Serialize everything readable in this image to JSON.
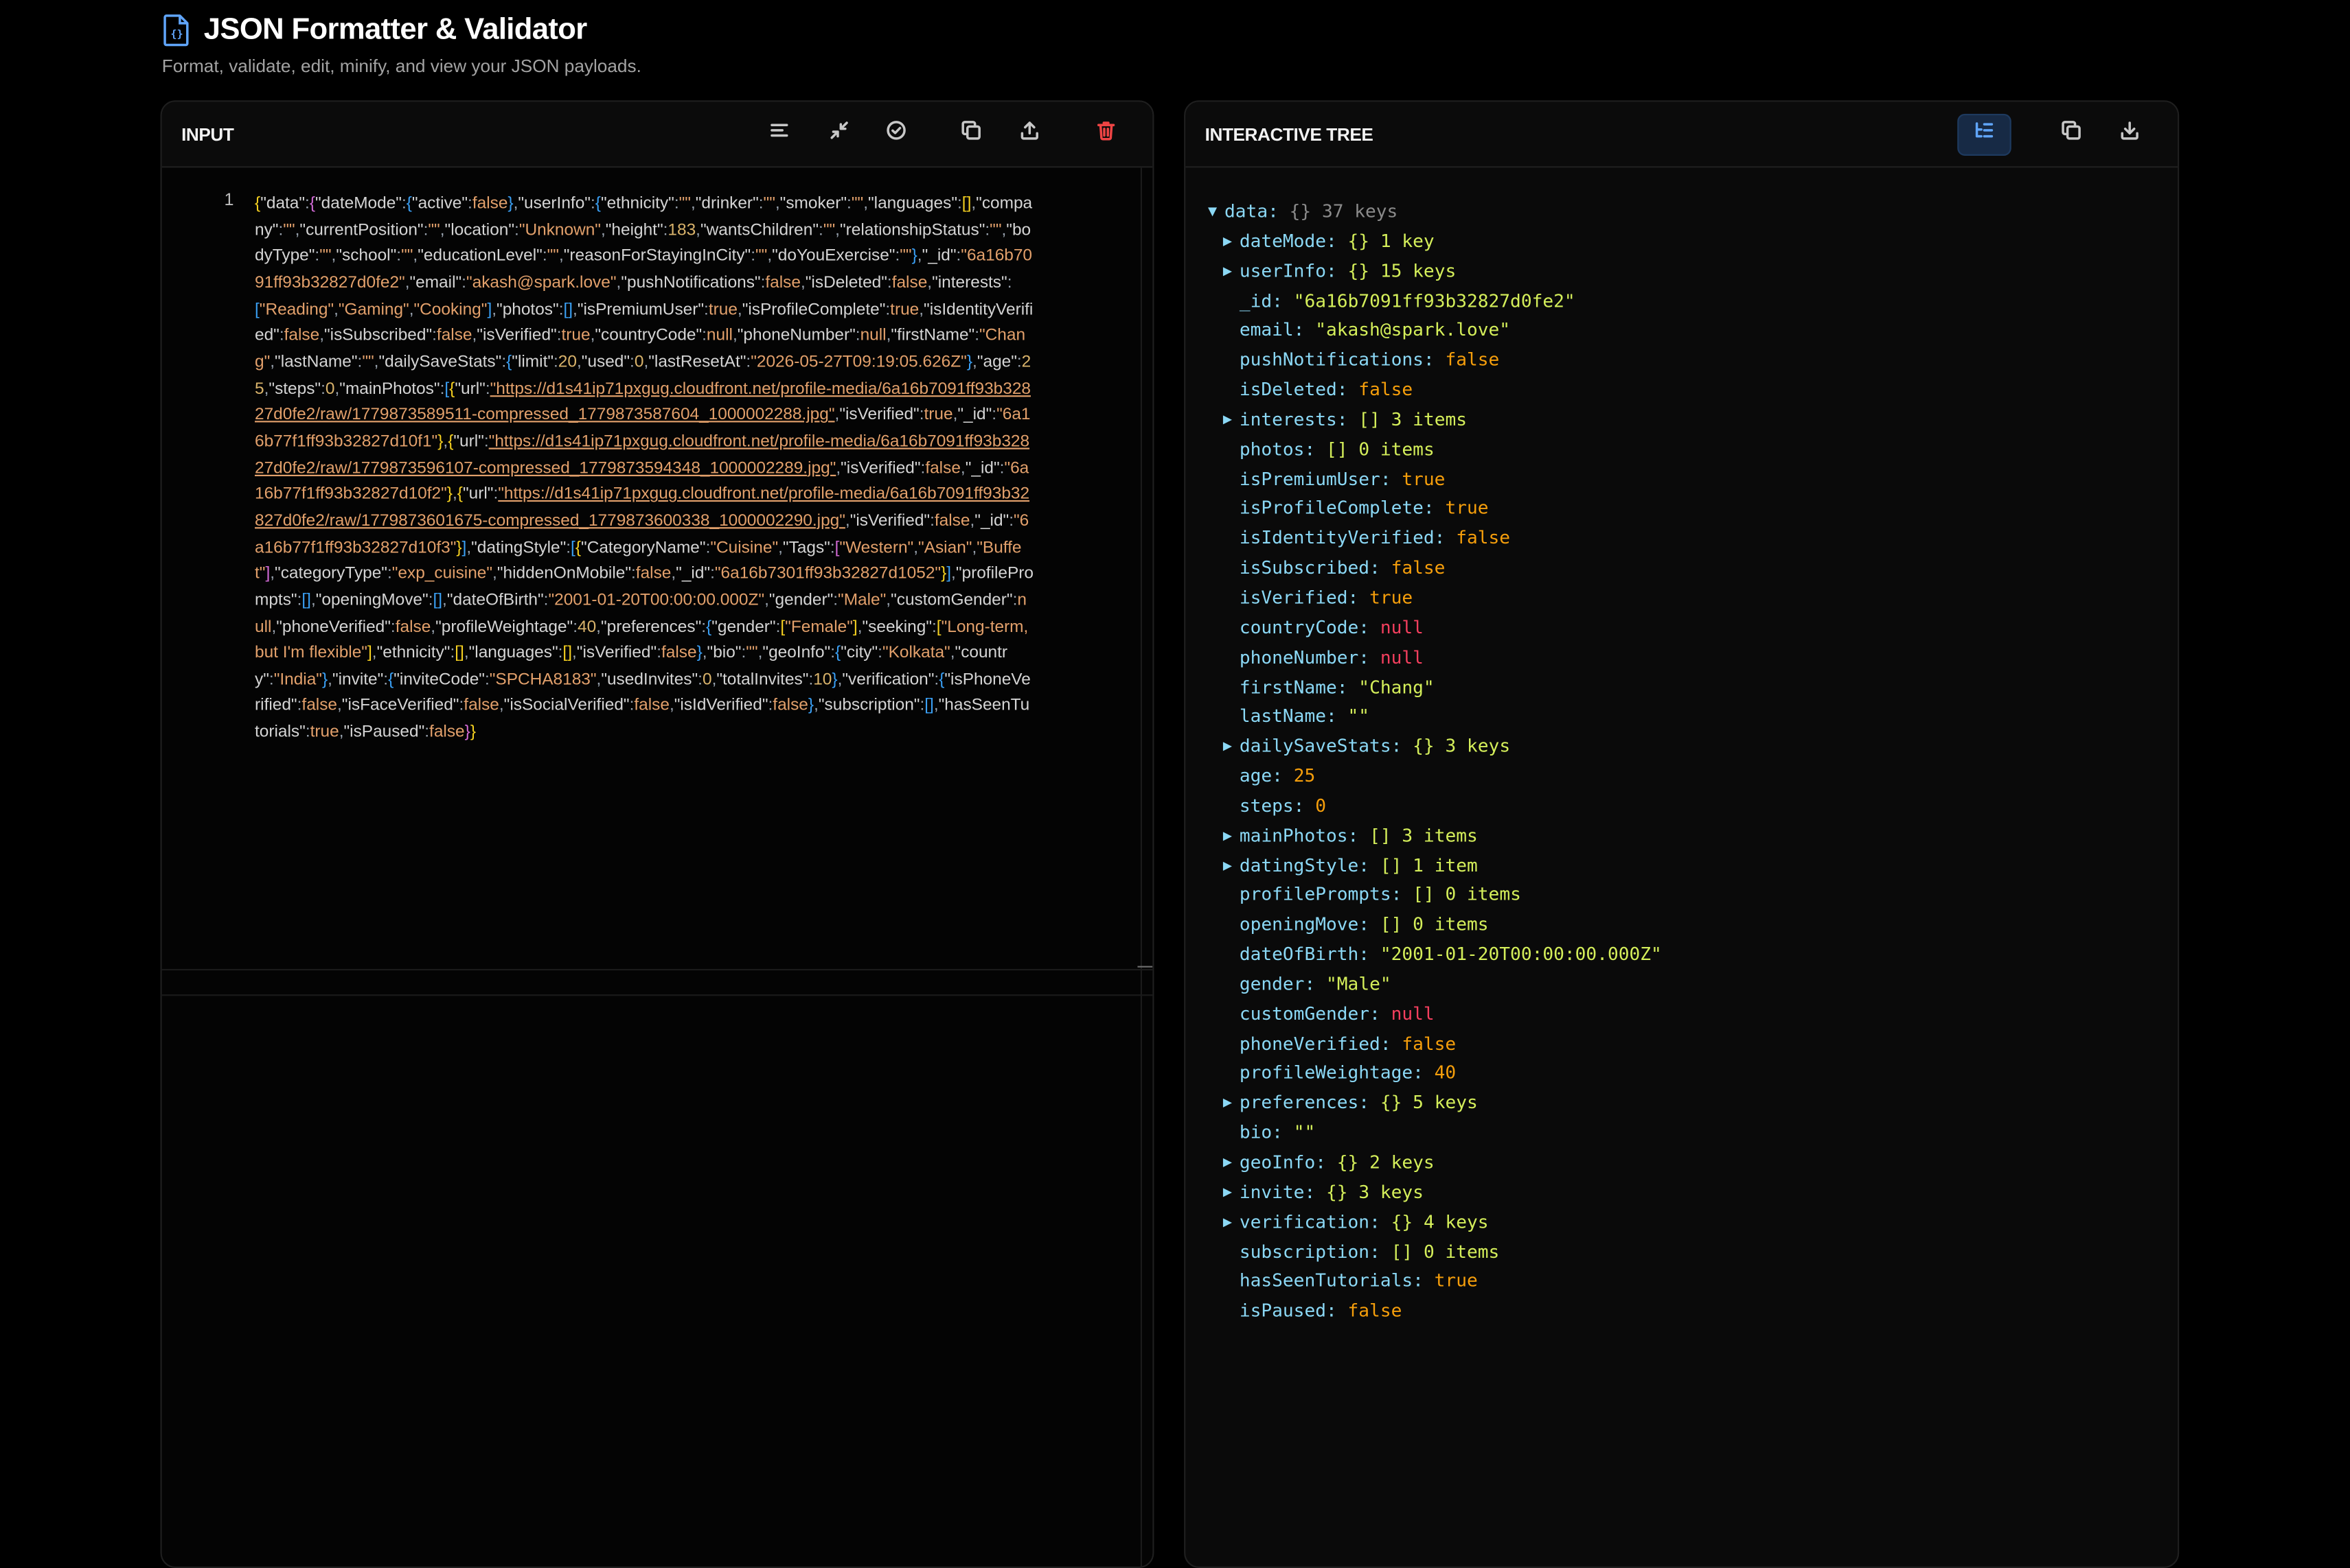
{
  "header": {
    "title": "JSON Formatter & Validator",
    "subtitle": "Format, validate, edit, minify, and view your JSON payloads."
  },
  "input_panel": {
    "label": "INPUT",
    "line_number": "1"
  },
  "tree_panel": {
    "label": "INTERACTIVE TREE",
    "root_key": "data",
    "root_meta": "{} 37 keys"
  },
  "raw_json": "{\"data\":{\"dateMode\":{\"active\":false},\"userInfo\":{\"ethnicity\":\"\",\"drinker\":\"\",\"smoker\":\"\",\"languages\":[],\"company\":\"\",\"currentPosition\":\"\",\"location\":\"Unknown\",\"height\":183,\"wantsChildren\":\"\",\"relationshipStatus\":\"\",\"bodyType\":\"\",\"school\":\"\",\"educationLevel\":\"\",\"reasonForStayingInCity\":\"\",\"doYouExercise\":\"\"},\"_id\":\"6a16b7091ff93b32827d0fe2\",\"email\":\"akash@spark.love\",\"pushNotifications\":false,\"isDeleted\":false,\"interests\":[\"Reading\",\"Gaming\",\"Cooking\"],\"photos\":[],\"isPremiumUser\":true,\"isProfileComplete\":true,\"isIdentityVerified\":false,\"isSubscribed\":false,\"isVerified\":true,\"countryCode\":null,\"phoneNumber\":null,\"firstName\":\"Chang\",\"lastName\":\"\",\"dailySaveStats\":{\"limit\":20,\"used\":0,\"lastResetAt\":\"2026-05-27T09:19:05.626Z\"},\"age\":25,\"steps\":0,\"mainPhotos\":[{\"url\":\"https://d1s41ip71pxgug.cloudfront.net/profile-media/6a16b7091ff93b32827d0fe2/raw/1779873589511-compressed_1779873587604_1000002288.jpg\",\"isVerified\":true,\"_id\":\"6a16b77f1ff93b32827d10f1\"},{\"url\":\"https://d1s41ip71pxgug.cloudfront.net/profile-media/6a16b7091ff93b32827d0fe2/raw/1779873596107-compressed_1779873594348_1000002289.jpg\",\"isVerified\":false,\"_id\":\"6a16b77f1ff93b32827d10f2\"},{\"url\":\"https://d1s41ip71pxgug.cloudfront.net/profile-media/6a16b7091ff93b32827d0fe2/raw/1779873601675-compressed_1779873600338_1000002290.jpg\",\"isVerified\":false,\"_id\":\"6a16b77f1ff93b32827d10f3\"}],\"datingStyle\":[{\"CategoryName\":\"Cuisine\",\"Tags\":[\"Western\",\"Asian\",\"Buffet\"],\"categoryType\":\"exp_cuisine\",\"hiddenOnMobile\":false,\"_id\":\"6a16b7301ff93b32827d1052\"}],\"profilePrompts\":[],\"openingMove\":[],\"dateOfBirth\":\"2001-01-20T00:00:00.000Z\",\"gender\":\"Male\",\"customGender\":null,\"phoneVerified\":false,\"profileWeightage\":40,\"preferences\":{\"gender\":[\"Female\"],\"seeking\":[\"Long-term, but I'm flexible\"],\"ethnicity\":[],\"languages\":[],\"isVerified\":false},\"bio\":\"\",\"geoInfo\":{\"city\":\"Kolkata\",\"country\":\"India\"},\"invite\":{\"inviteCode\":\"SPCHA8183\",\"usedInvites\":0,\"totalInvites\":10},\"verification\":{\"isPhoneVerified\":false,\"isFaceVerified\":false,\"isSocialVerified\":false,\"isIdVerified\":false},\"subscription\":[],\"hasSeenTutorials\":true,\"isPaused\":false}}",
  "tree_rows": [
    {
      "key": "dateMode",
      "type": "obj",
      "meta": "{}",
      "count": "1 key",
      "expandable": true
    },
    {
      "key": "userInfo",
      "type": "obj",
      "meta": "{}",
      "count": "15 keys",
      "expandable": true
    },
    {
      "key": "_id",
      "type": "str",
      "value": "\"6a16b7091ff93b32827d0fe2\""
    },
    {
      "key": "email",
      "type": "str",
      "value": "\"akash@spark.love\""
    },
    {
      "key": "pushNotifications",
      "type": "bool",
      "value": "false"
    },
    {
      "key": "isDeleted",
      "type": "bool",
      "value": "false"
    },
    {
      "key": "interests",
      "type": "arr",
      "meta": "[]",
      "count": "3 items",
      "expandable": true
    },
    {
      "key": "photos",
      "type": "arr",
      "meta": "[]",
      "count": "0 items",
      "expandable": false
    },
    {
      "key": "isPremiumUser",
      "type": "bool",
      "value": "true"
    },
    {
      "key": "isProfileComplete",
      "type": "bool",
      "value": "true"
    },
    {
      "key": "isIdentityVerified",
      "type": "bool",
      "value": "false"
    },
    {
      "key": "isSubscribed",
      "type": "bool",
      "value": "false"
    },
    {
      "key": "isVerified",
      "type": "bool",
      "value": "true"
    },
    {
      "key": "countryCode",
      "type": "null",
      "value": "null"
    },
    {
      "key": "phoneNumber",
      "type": "null",
      "value": "null"
    },
    {
      "key": "firstName",
      "type": "str",
      "value": "\"Chang\""
    },
    {
      "key": "lastName",
      "type": "str",
      "value": "\"\""
    },
    {
      "key": "dailySaveStats",
      "type": "obj",
      "meta": "{}",
      "count": "3 keys",
      "expandable": true
    },
    {
      "key": "age",
      "type": "num",
      "value": "25"
    },
    {
      "key": "steps",
      "type": "num",
      "value": "0"
    },
    {
      "key": "mainPhotos",
      "type": "arr",
      "meta": "[]",
      "count": "3 items",
      "expandable": true
    },
    {
      "key": "datingStyle",
      "type": "arr",
      "meta": "[]",
      "count": "1 item",
      "expandable": true
    },
    {
      "key": "profilePrompts",
      "type": "arr",
      "meta": "[]",
      "count": "0 items",
      "expandable": false
    },
    {
      "key": "openingMove",
      "type": "arr",
      "meta": "[]",
      "count": "0 items",
      "expandable": false
    },
    {
      "key": "dateOfBirth",
      "type": "str",
      "value": "\"2001-01-20T00:00:00.000Z\""
    },
    {
      "key": "gender",
      "type": "str",
      "value": "\"Male\""
    },
    {
      "key": "customGender",
      "type": "null",
      "value": "null"
    },
    {
      "key": "phoneVerified",
      "type": "bool",
      "value": "false"
    },
    {
      "key": "profileWeightage",
      "type": "num",
      "value": "40"
    },
    {
      "key": "preferences",
      "type": "obj",
      "meta": "{}",
      "count": "5 keys",
      "expandable": true
    },
    {
      "key": "bio",
      "type": "str",
      "value": "\"\""
    },
    {
      "key": "geoInfo",
      "type": "obj",
      "meta": "{}",
      "count": "2 keys",
      "expandable": true
    },
    {
      "key": "invite",
      "type": "obj",
      "meta": "{}",
      "count": "3 keys",
      "expandable": true
    },
    {
      "key": "verification",
      "type": "obj",
      "meta": "{}",
      "count": "4 keys",
      "expandable": true
    },
    {
      "key": "subscription",
      "type": "arr",
      "meta": "[]",
      "count": "0 items",
      "expandable": false
    },
    {
      "key": "hasSeenTutorials",
      "type": "bool",
      "value": "true"
    },
    {
      "key": "isPaused",
      "type": "bool",
      "value": "false"
    }
  ],
  "toolbar_input": [
    "format-icon",
    "minify-icon",
    "validate-icon",
    "copy-icon",
    "upload-icon",
    "trash-icon"
  ],
  "toolbar_tree": [
    "tree-view-icon",
    "copy-icon",
    "download-icon"
  ]
}
